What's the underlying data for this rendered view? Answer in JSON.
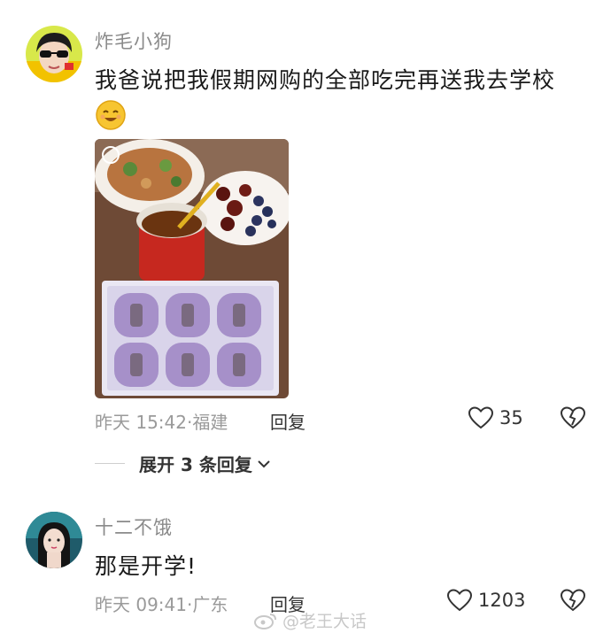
{
  "comments": [
    {
      "username": "炸毛小狗",
      "text": "我爸说把我假期网购的全部吃完再送我去学校",
      "time": "昨天 15:42",
      "location": "福建",
      "reply_label": "回复",
      "likes": "35",
      "expand_label": "展开 3 条回复"
    },
    {
      "username": "十二不饿",
      "text": "那是开学!",
      "time": "昨天 09:41",
      "location": "广东",
      "reply_label": "回复",
      "likes": "1203"
    }
  ],
  "watermark": "@老王大话"
}
